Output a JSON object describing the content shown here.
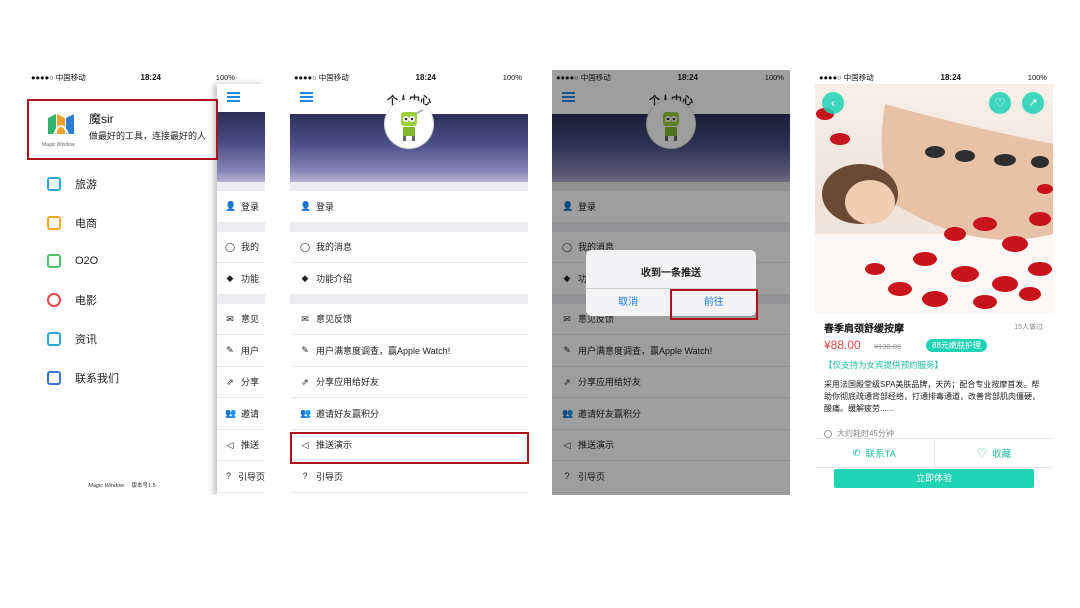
{
  "status": {
    "carrier": "●●●●○ 中国移动",
    "time": "18:24",
    "battery": "100%"
  },
  "drawer": {
    "brand_name": "魔sir",
    "brand_tagline": "做最好的工具，连接最好的人",
    "logo_text": "Magic Window",
    "items": [
      {
        "label": "旅游",
        "icon": "airplane-icon",
        "color": "#29a9d6"
      },
      {
        "label": "电商",
        "icon": "cart-icon",
        "color": "#f5a623"
      },
      {
        "label": "O2O",
        "icon": "store-icon",
        "color": "#4cc36b"
      },
      {
        "label": "电影",
        "icon": "film-reel-icon",
        "color": "#e5484d"
      },
      {
        "label": "资讯",
        "icon": "news-icon",
        "color": "#29a9d6"
      },
      {
        "label": "联系我们",
        "icon": "phone-icon",
        "color": "#3a6fd8"
      }
    ],
    "footer_logo": "Magic Window",
    "footer_version": "版本号1.5"
  },
  "profile": {
    "title": "个人中心",
    "groups": [
      [
        {
          "label": "登录",
          "icon": "user-icon"
        }
      ],
      [
        {
          "label": "我的消息",
          "icon": "message-icon"
        },
        {
          "label": "功能介绍",
          "icon": "book-icon"
        }
      ],
      [
        {
          "label": "意见反馈",
          "icon": "mail-icon"
        },
        {
          "label": "用户满意度调查，赢Apple Watch!",
          "icon": "edit-icon"
        },
        {
          "label": "分享应用给好友",
          "icon": "share-icon"
        },
        {
          "label": "邀请好友赢积分",
          "icon": "users-icon"
        },
        {
          "label": "推送演示",
          "icon": "send-icon"
        },
        {
          "label": "引导页",
          "icon": "help-icon"
        }
      ]
    ],
    "drawer_peek_labels": [
      "登录",
      "我的",
      "功能",
      "意见",
      "用户",
      "分享",
      "邀请",
      "推送",
      "引导页"
    ]
  },
  "dialog": {
    "title": "收到一条推送",
    "cancel": "取消",
    "confirm": "前往",
    "peek_message": "我的消息"
  },
  "product": {
    "title": "春季肩颈舒缓按摩",
    "sold": "15人做过",
    "price": "¥88.00",
    "original_price": "¥138.00",
    "tag": "88元嫩肤护理",
    "note": "【仅支持为女宾提供预约服务】",
    "description": "采用法国殿堂级SPA美肤品牌，天芮；配合专业按摩首发。帮助你彻底疏通背部经络，打通排毒通道，改善背部肌肉僵硬，酸痛。缓解疲劳......",
    "duration": "大约耗时45分钟",
    "contact": "联系TA",
    "favorite": "收藏",
    "cta": "立即体验",
    "accent": "#1fd3b4"
  }
}
